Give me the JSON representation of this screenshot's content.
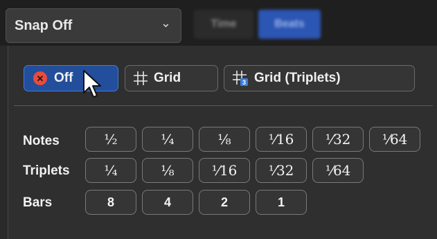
{
  "header": {
    "snap_label": "Snap Off",
    "dropdown_icon": "chevron-down-icon",
    "tabs": [
      {
        "label": "Time",
        "selected": false
      },
      {
        "label": "Beats",
        "selected": true
      }
    ]
  },
  "modes": [
    {
      "label": "Off",
      "icon": "off-x-circle-icon",
      "selected": true
    },
    {
      "label": "Grid",
      "icon": "grid-icon",
      "selected": false
    },
    {
      "label": "Grid (Triplets)",
      "icon": "grid-triplets-icon",
      "selected": false
    }
  ],
  "rows": {
    "notes": {
      "label": "Notes",
      "values": [
        "½",
        "¼",
        "⅛",
        "⅟16",
        "⅟32",
        "⅟64"
      ]
    },
    "triplets": {
      "label": "Triplets",
      "values": [
        "¼",
        "⅛",
        "⅟16",
        "⅟32",
        "⅟64"
      ]
    },
    "bars": {
      "label": "Bars",
      "values": [
        "8",
        "4",
        "2",
        "1"
      ]
    }
  },
  "colors": {
    "accent": "#224e9b",
    "off_icon": "#e94b3c",
    "beats_tab": "#2c56b3"
  }
}
